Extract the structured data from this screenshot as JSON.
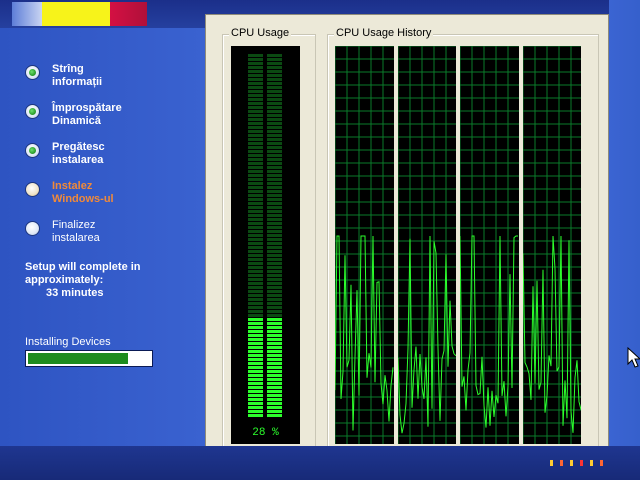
{
  "setup": {
    "steps": [
      {
        "label": "Strîng\ninformații",
        "state": "done"
      },
      {
        "label": "Împrospătare\nDinamică",
        "state": "done"
      },
      {
        "label": "Pregătesc\ninstalarea",
        "state": "done"
      },
      {
        "label": "Instalez\nWindows-ul",
        "state": "current"
      },
      {
        "label": "Finalizez\ninstalarea",
        "state": "pending"
      }
    ],
    "complete_line1": "Setup will complete in",
    "complete_line2": "approximately:",
    "complete_line3": "33 minutes",
    "installing_label": "Installing Devices",
    "installing_progress": 0.82
  },
  "task_manager": {
    "cpu_usage_title": "CPU Usage",
    "cpu_history_title": "CPU Usage History",
    "cpu_percent_text": "28 %",
    "cpu_percent": 28,
    "history_cores": 4
  },
  "colors": {
    "graph_green": "#2cff2c",
    "grid_green": "#0a7a2a",
    "accent_orange": "#f08a3a"
  }
}
